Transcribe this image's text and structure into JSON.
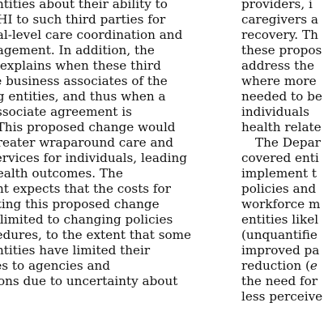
{
  "left_column": {
    "lines": [
      "entities about their ability to",
      "PHI to such third parties for",
      "nal-level care coordination and",
      "nagement. In addition, the",
      "e explains when these third",
      "re business associates of the",
      "ng entities, and thus when a",
      "associate agreement is",
      ". This proposed change would",
      "greater wraparound care and",
      "services for individuals, leading",
      "health outcomes. The",
      "ent expects that the costs for",
      "nting this proposed change",
      "e limited to changing policies",
      "cedures, to the extent that some",
      "entities have limited their",
      "res to agencies and",
      "tions due to uncertainty about",
      "li"
    ]
  },
  "right_column": {
    "lines": [
      "providers, i",
      "caregivers a",
      "recovery. Th",
      "these propos",
      "address the",
      "where more",
      "needed to be",
      "individuals",
      "health relate",
      "The Depar",
      "covered enti",
      "implement t",
      "policies and",
      "workforce m",
      "entities likel",
      "(unquantifie",
      "improved pa",
      "reduction (",
      "the need for",
      "less perceive"
    ],
    "italic_fragment": "e"
  }
}
